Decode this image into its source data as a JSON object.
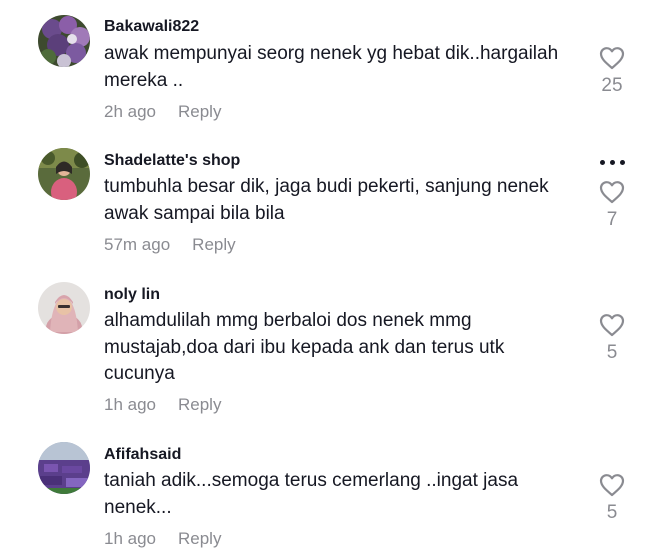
{
  "comments": [
    {
      "username": "Bakawali822",
      "text": "awak mempunyai seorg nenek yg hebat dik..hargailah mereka ..",
      "time": "2h ago",
      "reply_label": "Reply",
      "likes": "25",
      "avatar": "flower-bouquet-photo"
    },
    {
      "username": "Shadelatte's shop",
      "text": "tumbuhla besar dik, jaga budi pekerti, sanjung nenek awak sampai bila bila",
      "time": "57m ago",
      "reply_label": "Reply",
      "likes": "7",
      "avatar": "woman-pink-outfit-photo",
      "more_icon": "more-horizontal-icon"
    },
    {
      "username": "noly lin",
      "text": "alhamdulilah mmg berbaloi dos nenek mmg mustajab,doa dari ibu kepada ank dan terus utk cucunya",
      "time": "1h ago",
      "reply_label": "Reply",
      "likes": "5",
      "avatar": "woman-pink-hijab-photo"
    },
    {
      "username": "Afifahsaid",
      "text": "taniah adik...semoga terus cemerlang ..ingat jasa nenek...",
      "time": "1h ago",
      "reply_label": "Reply",
      "likes": "5",
      "avatar": "purple-field-photo"
    }
  ],
  "icons": {
    "like": "heart-outline-icon",
    "more": "more-horizontal-icon"
  },
  "colors": {
    "text": "#161823",
    "secondary": "#8a8b91",
    "background": "#ffffff"
  }
}
